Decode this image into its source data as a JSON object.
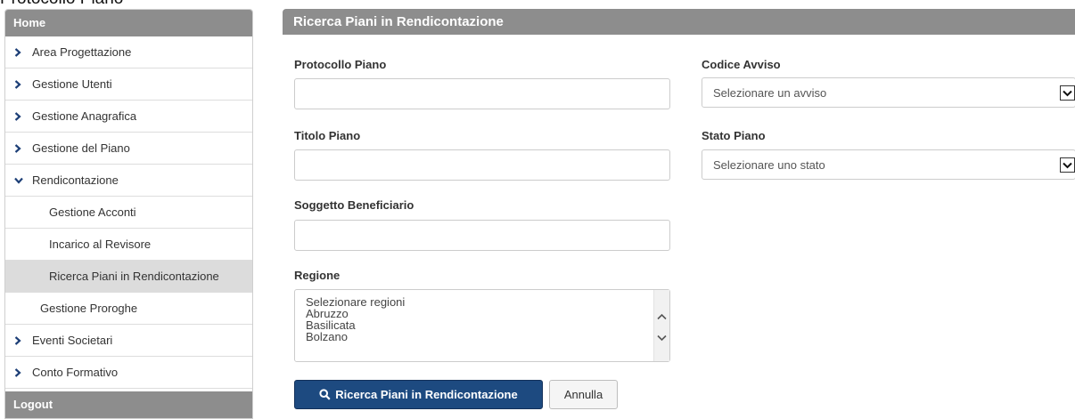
{
  "page": {
    "heading": "Protocollo Piano"
  },
  "sidebar": {
    "header": "Home",
    "items": [
      {
        "label": "Area Progettazione"
      },
      {
        "label": "Gestione Utenti"
      },
      {
        "label": "Gestione Anagrafica"
      },
      {
        "label": "Gestione del Piano"
      },
      {
        "label": "Rendicontazione"
      },
      {
        "label": "Gestione Acconti"
      },
      {
        "label": "Incarico al Revisore"
      },
      {
        "label": "Ricerca Piani in Rendicontazione"
      },
      {
        "label": "Gestione Proroghe"
      },
      {
        "label": "Eventi Societari"
      },
      {
        "label": "Conto Formativo"
      }
    ],
    "footer": "Logout"
  },
  "panel": {
    "title": "Ricerca Piani in Rendicontazione"
  },
  "form": {
    "protocollo_label": "Protocollo Piano",
    "protocollo_value": "",
    "codice_avviso_label": "Codice Avviso",
    "codice_avviso_selected": "Selezionare un avviso",
    "titolo_label": "Titolo Piano",
    "titolo_value": "",
    "stato_label": "Stato Piano",
    "stato_selected": "Selezionare uno stato",
    "soggetto_label": "Soggetto Beneficiario",
    "soggetto_value": "",
    "regione_label": "Regione",
    "regione_options": [
      "Selezionare regioni",
      "Abruzzo",
      "Basilicata",
      "Bolzano"
    ]
  },
  "actions": {
    "search_label": "Ricerca Piani in Rendicontazione",
    "cancel_label": "Annulla"
  },
  "colors": {
    "header_gray": "#8d8d8d",
    "primary": "#1d4a80",
    "chevron": "#1d3f77",
    "active_item": "#dcdcdc"
  }
}
